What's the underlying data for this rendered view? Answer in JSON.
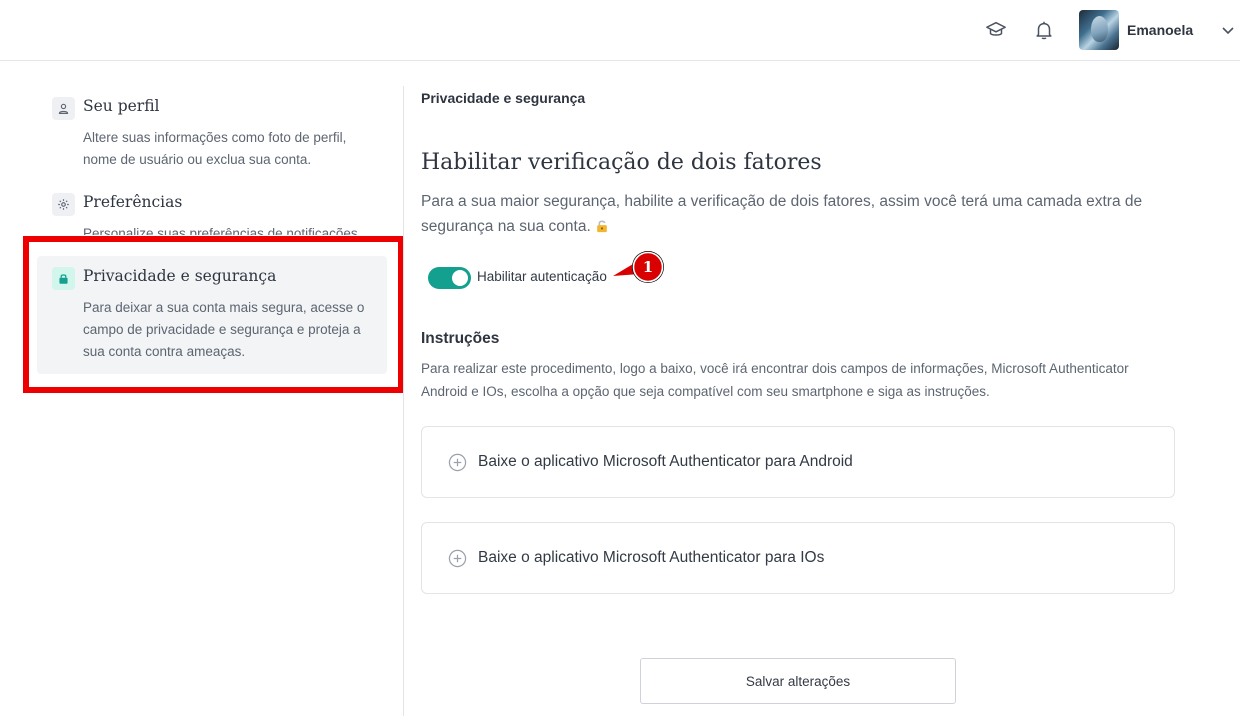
{
  "header": {
    "username": "Emanoela",
    "icons": [
      "graduation-cap-icon",
      "bell-icon",
      "chevron-down-icon"
    ]
  },
  "sidebar": {
    "items": [
      {
        "title": "Seu perfil",
        "description": "Altere suas informações como foto de perfil, nome de usuário ou exclua sua conta.",
        "icon": "user-icon"
      },
      {
        "title": "Preferências",
        "description": "Personalize suas preferências de notificações.",
        "icon": "gear-icon"
      },
      {
        "title": "Privacidade e segurança",
        "description": "Para deixar a sua conta mais segura, acesse o campo de privacidade e segurança e proteja a sua conta contra ameaças.",
        "icon": "lock-icon",
        "active": true
      }
    ]
  },
  "main": {
    "breadcrumb": "Privacidade e segurança",
    "title": "Habilitar verificação de dois fatores",
    "intro": "Para a sua maior segurança, habilite a verificação de dois fatores, assim você terá uma camada extra de segurança na sua conta.",
    "toggle": {
      "label": "Habilitar autenticação",
      "on": true
    },
    "callout_number": "1",
    "instructions": {
      "title": "Instruções",
      "text": "Para realizar este procedimento, logo a baixo, você irá encontrar dois campos de informações, Microsoft Authenticator Android e IOs, escolha a opção que seja compatível com seu smartphone e siga as instruções."
    },
    "accordions": [
      {
        "label": "Baixe o aplicativo Microsoft Authenticator para Android"
      },
      {
        "label": "Baixe o aplicativo Microsoft Authenticator para IOs"
      }
    ],
    "save_label": "Salvar alterações"
  },
  "colors": {
    "accent": "#13a08f",
    "highlight": "#ee0000",
    "callout": "#d80000"
  }
}
